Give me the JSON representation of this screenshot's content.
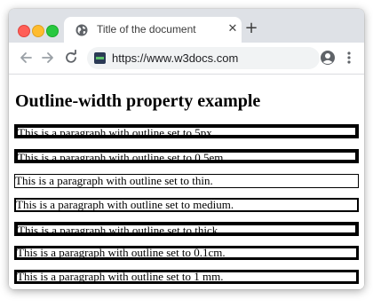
{
  "browser": {
    "tab": {
      "title": "Title of the document",
      "icon": "globe-icon",
      "close_icon": "close-icon"
    },
    "new_tab_icon": "plus-icon",
    "toolbar": {
      "back_icon": "back-arrow-icon",
      "forward_icon": "forward-arrow-icon",
      "reload_icon": "reload-icon",
      "site_icon": "site-favicon-icon",
      "url": "https://www.w3docs.com",
      "profile_icon": "profile-icon",
      "menu_icon": "kebab-menu-icon"
    }
  },
  "page": {
    "heading": "Outline-width property example",
    "paragraphs": [
      "This is a paragraph with outline set to 5px.",
      "This is a paragraph with outline set to 0.5em.",
      "This is a paragraph with outline set to thin.",
      "This is a paragraph with outline set to medium.",
      "This is a paragraph with outline set to thick.",
      "This is a paragraph with outline set to 0.1cm.",
      "This is a paragraph with outline set to 1 mm."
    ]
  },
  "colors": {
    "tabstrip": "#dee1e6",
    "omnibox": "#f1f3f4",
    "traffic_red": "#ff5f57",
    "traffic_yellow": "#febc2e",
    "traffic_green": "#28c840",
    "outline": "#000000"
  }
}
